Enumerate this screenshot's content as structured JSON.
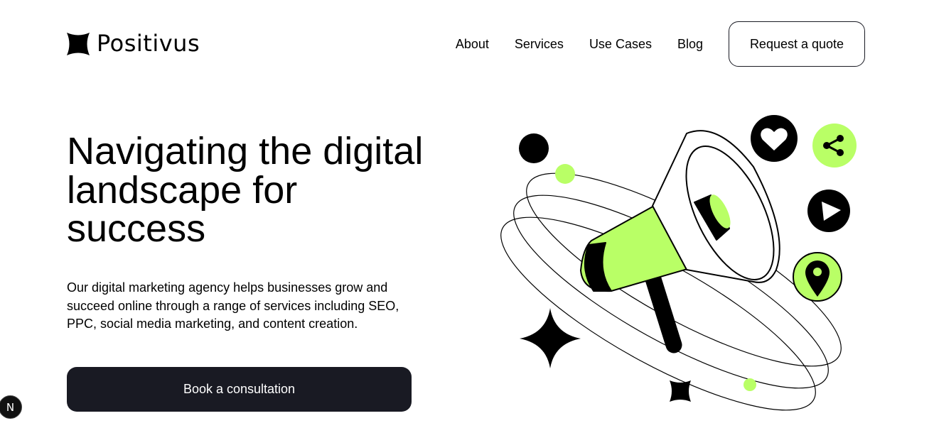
{
  "header": {
    "logo": {
      "text": "Positivus",
      "icon": "positivus-star-icon"
    },
    "nav": [
      {
        "label": "About"
      },
      {
        "label": "Services"
      },
      {
        "label": "Use Cases"
      },
      {
        "label": "Blog"
      }
    ],
    "quote_button": "Request a quote"
  },
  "hero": {
    "headline": "Navigating the digital landscape for success",
    "description": "Our digital marketing agency helps businesses grow and succeed online through a range of services including SEO, PPC, social media marketing, and content creation.",
    "cta": "Book a consultation",
    "illustration_icons": [
      "megaphone-icon",
      "heart-icon",
      "share-icon",
      "play-icon",
      "location-pin-icon",
      "sparkle-icon",
      "star-icon"
    ]
  },
  "dev_badge": "N",
  "colors": {
    "accent": "#b9ff66",
    "dark": "#191a23",
    "background": "#ffffff"
  }
}
